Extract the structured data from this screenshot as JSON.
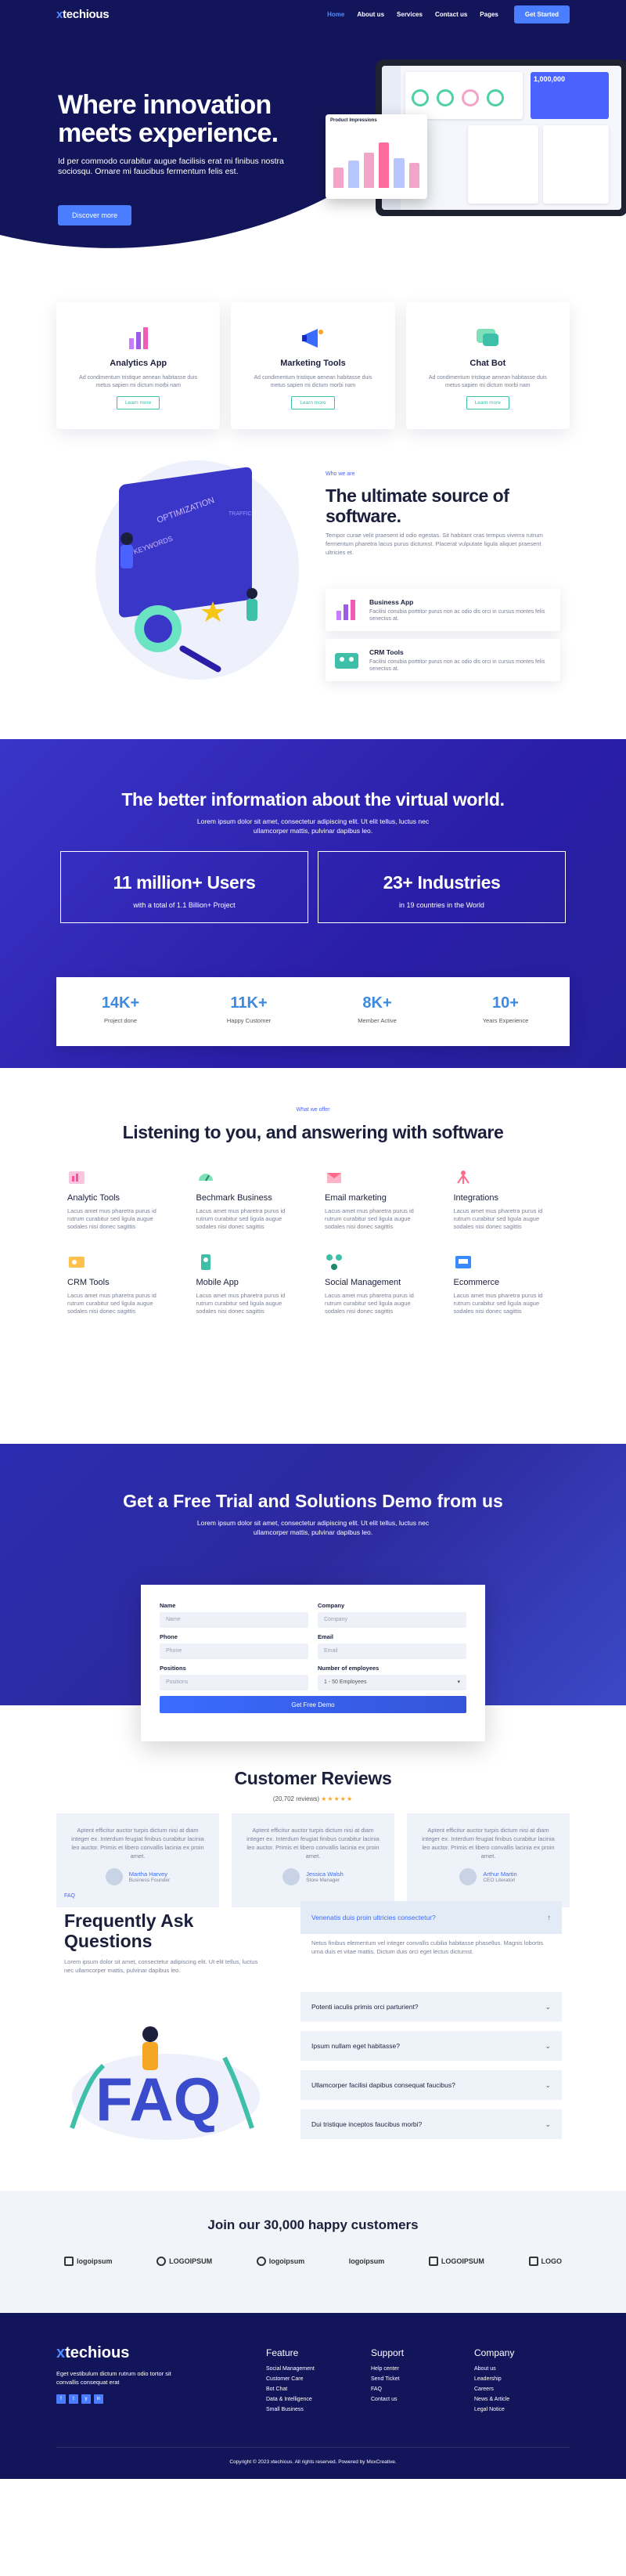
{
  "nav": {
    "logo_x": "x",
    "logo_rest": "techious",
    "items": [
      "Home",
      "About us",
      "Services",
      "Contact us",
      "Pages"
    ],
    "cta": "Get Started"
  },
  "hero": {
    "title": "Where innovation meets experience.",
    "text": "Id per commodo curabitur augue facilisis erat mi finibus nostra sociosqu. Ornare mi faucibus fermentum felis est.",
    "button": "Discover more",
    "chart_title": "Product Impressions",
    "dash_value": "1,000,000"
  },
  "services": [
    {
      "title": "Analytics App",
      "text": "Ad condimentum tristique aenean habitasse duis metus sapien mi dictum morbi nam",
      "button": "Learn more"
    },
    {
      "title": "Marketing Tools",
      "text": "Ad condimentum tristique aenean habitasse duis metus sapien mi dictum morbi nam",
      "button": "Learn more"
    },
    {
      "title": "Chat Bot",
      "text": "Ad condimentum tristique aenean habitasse duis metus sapien mi dictum morbi nam",
      "button": "Learn more"
    }
  ],
  "ultimate": {
    "sub": "Who we are",
    "title": "The ultimate source of software.",
    "text": "Tempor curae velit praesent id odio egestas. Sit habitant cras tempus viverra rutrum fermentum pharetra lacus purus dictumst. Placerat vulputate ligula aliquet praesent ultricies et.",
    "features": [
      {
        "title": "Business App",
        "text": "Facilisi conubia porttitor purus non ac odio dis orci in cursus montes felis senectus at."
      },
      {
        "title": "CRM Tools",
        "text": "Facilisi conubia porttitor purus non ac odio dis orci in cursus montes felis senectus at."
      }
    ],
    "ill_words": [
      "OPTIMIZATION",
      "KEYWORDS",
      "TRAFFIC"
    ]
  },
  "virtual": {
    "title": "The better information about the virtual world.",
    "text": "Lorem ipsum dolor sit amet, consectetur adipiscing elit. Ut elit tellus, luctus nec ullamcorper mattis, pulvinar dapibus leo.",
    "big": [
      {
        "num": "11 million+ Users",
        "label": "with a total of 1.1 Billion+ Project"
      },
      {
        "num": "23+ Industries",
        "label": "in 19 countries in the World"
      }
    ],
    "stats": [
      {
        "num": "14K+",
        "label": "Project done"
      },
      {
        "num": "11K+",
        "label": "Happy Customer"
      },
      {
        "num": "8K+",
        "label": "Member Active"
      },
      {
        "num": "10+",
        "label": "Years Experience"
      }
    ]
  },
  "solutions": {
    "sub": "What we offer",
    "title": "Listening to you, and answering with software",
    "items": [
      {
        "title": "Analytic Tools",
        "text": "Lacus amet mus pharetra purus id rutrum curabitur sed ligula augue sodales nisi donec sagittis"
      },
      {
        "title": "Bechmark Business",
        "text": "Lacus amet mus pharetra purus id rutrum curabitur sed ligula augue sodales nisi donec sagittis"
      },
      {
        "title": "Email marketing",
        "text": "Lacus amet mus pharetra purus id rutrum curabitur sed ligula augue sodales nisi donec sagittis"
      },
      {
        "title": "Integrations",
        "text": "Lacus amet mus pharetra purus id rutrum curabitur sed ligula augue sodales nisi donec sagittis"
      },
      {
        "title": "CRM Tools",
        "text": "Lacus amet mus pharetra purus id rutrum curabitur sed ligula augue sodales nisi donec sagittis"
      },
      {
        "title": "Mobile App",
        "text": "Lacus amet mus pharetra purus id rutrum curabitur sed ligula augue sodales nisi donec sagittis"
      },
      {
        "title": "Social Management",
        "text": "Lacus amet mus pharetra purus id rutrum curabitur sed ligula augue sodales nisi donec sagittis"
      },
      {
        "title": "Ecommerce",
        "text": "Lacus amet mus pharetra purus id rutrum curabitur sed ligula augue sodales nisi donec sagittis"
      }
    ]
  },
  "demo": {
    "title": "Get a Free Trial and Solutions Demo from us",
    "text": "Lorem ipsum dolor sit amet, consectetur adipiscing elit. Ut elit tellus, luctus nec ullamcorper mattis, pulvinar dapibus leo.",
    "fields": {
      "name_label": "Name",
      "name_ph": "Name",
      "company_label": "Company",
      "company_ph": "Company",
      "phone_label": "Phone",
      "phone_ph": "Phone",
      "email_label": "Email",
      "email_ph": "Email",
      "positions_label": "Positions",
      "positions_ph": "Positions",
      "employees_label": "Number of employees",
      "employees_value": "1 - 50 Employees"
    },
    "button": "Get Free Demo"
  },
  "reviews": {
    "title": "Customer Reviews",
    "count": "(20,702 reviews)",
    "stars": "★★★★★",
    "items": [
      {
        "text": "Aptent efficitur auctor turpis dictum nisi at diam integer ex. Interdum feugiat finibus curabitur lacinia leo auctor. Primis et libero convallis lacinia ex proin amet.",
        "name": "Martha Harvey",
        "role": "Business Founder"
      },
      {
        "text": "Aptent efficitur auctor turpis dictum nisi at diam integer ex. Interdum feugiat finibus curabitur lacinia leo auctor. Primis et libero convallis lacinia ex proin amet.",
        "name": "Jessica Walsh",
        "role": "Store Manager"
      },
      {
        "text": "Aptent efficitur auctor turpis dictum nisi at diam integer ex. Interdum feugiat finibus curabitur lacinia leo auctor. Primis et libero convallis lacinia ex proin amet.",
        "name": "Arthur Martin",
        "role": "CEO Literatori"
      }
    ]
  },
  "faq": {
    "sub": "FAQ",
    "title": "Frequently Ask Questions",
    "text": "Lorem ipsum dolor sit amet, consectetur adipiscing elit. Ut elit tellus, luctus nec ullamcorper mattis, pulvinar dapibus leo.",
    "ill_text": "FAQ",
    "open_q": "Venenatis duis proin ultricies consectetur?",
    "open_a": "Netus finibus elementum vel integer convallis cubilia habitasse phasellus. Magnis lobortis urna duis et vitae mattis. Dictum duis orci eget lectus dictumst.",
    "questions": [
      "Potenti iaculis primis orci parturient?",
      "Ipsum nullam eget habitasse?",
      "Ullamcorper facilisi dapibus consequat faucibus?",
      "Dui tristique inceptos faucibus morbi?"
    ]
  },
  "join": {
    "title": "Join our 30,000 happy customers",
    "logos": [
      "logoipsum",
      "LOGOIPSUM",
      "logoipsum",
      "logoipsum",
      "LOGOIPSUM",
      "LOGO"
    ]
  },
  "footer": {
    "logo_x": "x",
    "logo_rest": "techious",
    "text": "Eget vestibulum dictum rutrum odio tortor sit convallis consequat erat",
    "social": [
      "f",
      "t",
      "y",
      "in"
    ],
    "cols": [
      {
        "title": "Feature",
        "links": [
          "Social Management",
          "Customer Care",
          "Bot Chat",
          "Data & Intelligence",
          "Small Business"
        ]
      },
      {
        "title": "Support",
        "links": [
          "Help center",
          "Send Ticket",
          "FAQ",
          "Contact us"
        ]
      },
      {
        "title": "Company",
        "links": [
          "About us",
          "Leadership",
          "Careers",
          "News & Article",
          "Legal Notice"
        ]
      }
    ],
    "copyright": "Copyright © 2023 xtechious. All rights reserved. Powered by MoxCreative."
  },
  "colors": {
    "navy": "#13155a",
    "accent": "#4a7dff",
    "purple": "#2a1ea8",
    "teal": "#3dbfa8"
  }
}
